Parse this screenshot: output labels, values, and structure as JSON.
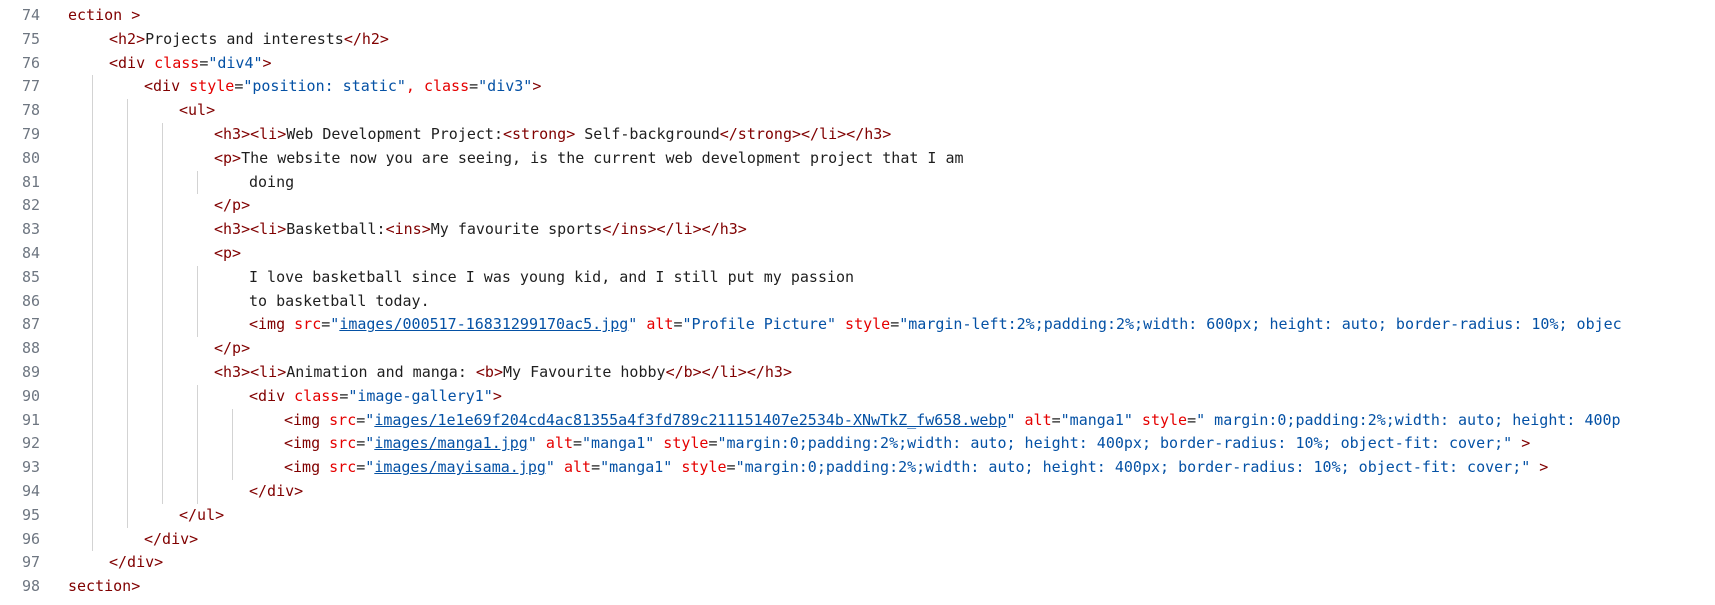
{
  "editor": {
    "lines": [
      {
        "number": "74",
        "indent": 0,
        "tokens": [
          {
            "c": "p",
            "t": "ection >"
          }
        ]
      },
      {
        "number": "75",
        "indent": 1,
        "tokens": [
          {
            "c": "p",
            "t": "<h2>"
          },
          {
            "c": "t",
            "t": "Projects and interests"
          },
          {
            "c": "p",
            "t": "</h2>"
          }
        ]
      },
      {
        "number": "76",
        "indent": 1,
        "tokens": [
          {
            "c": "p",
            "t": "<div "
          },
          {
            "c": "a",
            "t": "class"
          },
          {
            "c": "t",
            "t": "="
          },
          {
            "c": "v",
            "t": "\"div4\""
          },
          {
            "c": "p",
            "t": ">"
          }
        ]
      },
      {
        "number": "77",
        "indent": 2,
        "tokens": [
          {
            "c": "p",
            "t": "<div "
          },
          {
            "c": "a",
            "t": "style"
          },
          {
            "c": "t",
            "t": "="
          },
          {
            "c": "v",
            "t": "\"position: static\""
          },
          {
            "c": "a",
            "t": ", class"
          },
          {
            "c": "t",
            "t": "="
          },
          {
            "c": "v",
            "t": "\"div3\""
          },
          {
            "c": "p",
            "t": ">"
          }
        ]
      },
      {
        "number": "78",
        "indent": 3,
        "tokens": [
          {
            "c": "p",
            "t": "<ul>"
          }
        ]
      },
      {
        "number": "79",
        "indent": 4,
        "tokens": [
          {
            "c": "p",
            "t": "<h3><li>"
          },
          {
            "c": "t",
            "t": "Web Development Project:"
          },
          {
            "c": "p",
            "t": "<strong>"
          },
          {
            "c": "t",
            "t": " Self-background"
          },
          {
            "c": "p",
            "t": "</strong></li></h3>"
          }
        ]
      },
      {
        "number": "80",
        "indent": 4,
        "tokens": [
          {
            "c": "p",
            "t": "<p>"
          },
          {
            "c": "t",
            "t": "The website now you are seeing, is the current web development project that I am"
          }
        ]
      },
      {
        "number": "81",
        "indent": 5,
        "tokens": [
          {
            "c": "t",
            "t": "doing"
          }
        ]
      },
      {
        "number": "82",
        "indent": 4,
        "tokens": [
          {
            "c": "p",
            "t": "</p>"
          }
        ]
      },
      {
        "number": "83",
        "indent": 4,
        "tokens": [
          {
            "c": "p",
            "t": "<h3><li>"
          },
          {
            "c": "t",
            "t": "Basketball:"
          },
          {
            "c": "p",
            "t": "<ins>"
          },
          {
            "c": "t",
            "t": "My favourite sports"
          },
          {
            "c": "p",
            "t": "</ins></li></h3>"
          }
        ]
      },
      {
        "number": "84",
        "indent": 4,
        "tokens": [
          {
            "c": "p",
            "t": "<p>"
          }
        ]
      },
      {
        "number": "85",
        "indent": 5,
        "tokens": [
          {
            "c": "t",
            "t": "I love basketball since I was young kid, and I still put my passion"
          }
        ]
      },
      {
        "number": "86",
        "indent": 5,
        "tokens": [
          {
            "c": "t",
            "t": "to basketball today."
          }
        ]
      },
      {
        "number": "87",
        "indent": 5,
        "tokens": [
          {
            "c": "p",
            "t": "<img "
          },
          {
            "c": "a",
            "t": "src"
          },
          {
            "c": "t",
            "t": "="
          },
          {
            "c": "v",
            "t": "\""
          },
          {
            "c": "u",
            "t": "images/000517-16831299170ac5.jpg"
          },
          {
            "c": "v",
            "t": "\""
          },
          {
            "c": "a",
            "t": " alt"
          },
          {
            "c": "t",
            "t": "="
          },
          {
            "c": "v",
            "t": "\"Profile Picture\""
          },
          {
            "c": "a",
            "t": " style"
          },
          {
            "c": "t",
            "t": "="
          },
          {
            "c": "v",
            "t": "\"margin-left:2%;padding:2%;width: 600px; height: auto; border-radius: 10%; objec"
          }
        ]
      },
      {
        "number": "88",
        "indent": 4,
        "tokens": [
          {
            "c": "p",
            "t": "</p>"
          }
        ]
      },
      {
        "number": "89",
        "indent": 4,
        "tokens": [
          {
            "c": "p",
            "t": "<h3><li>"
          },
          {
            "c": "t",
            "t": "Animation and manga: "
          },
          {
            "c": "p",
            "t": "<b>"
          },
          {
            "c": "t",
            "t": "My Favourite hobby"
          },
          {
            "c": "p",
            "t": "</b></li></h3>"
          }
        ]
      },
      {
        "number": "90",
        "indent": 5,
        "tokens": [
          {
            "c": "p",
            "t": "<div "
          },
          {
            "c": "a",
            "t": "class"
          },
          {
            "c": "t",
            "t": "="
          },
          {
            "c": "v",
            "t": "\"image-gallery1\""
          },
          {
            "c": "p",
            "t": ">"
          }
        ]
      },
      {
        "number": "91",
        "indent": 6,
        "tokens": [
          {
            "c": "p",
            "t": "<img "
          },
          {
            "c": "a",
            "t": "src"
          },
          {
            "c": "t",
            "t": "="
          },
          {
            "c": "v",
            "t": "\""
          },
          {
            "c": "u",
            "t": "images/1e1e69f204cd4ac81355a4f3fd789c211151407e2534b-XNwTkZ_fw658.webp"
          },
          {
            "c": "v",
            "t": "\""
          },
          {
            "c": "a",
            "t": " alt"
          },
          {
            "c": "t",
            "t": "="
          },
          {
            "c": "v",
            "t": "\"manga1\""
          },
          {
            "c": "a",
            "t": " style"
          },
          {
            "c": "t",
            "t": "="
          },
          {
            "c": "v",
            "t": "\" margin:0;padding:2%;width: auto; height: 400p"
          }
        ]
      },
      {
        "number": "92",
        "indent": 6,
        "tokens": [
          {
            "c": "p",
            "t": "<img "
          },
          {
            "c": "a",
            "t": "src"
          },
          {
            "c": "t",
            "t": "="
          },
          {
            "c": "v",
            "t": "\""
          },
          {
            "c": "u",
            "t": "images/manga1.jpg"
          },
          {
            "c": "v",
            "t": "\""
          },
          {
            "c": "a",
            "t": " alt"
          },
          {
            "c": "t",
            "t": "="
          },
          {
            "c": "v",
            "t": "\"manga1\""
          },
          {
            "c": "a",
            "t": " style"
          },
          {
            "c": "t",
            "t": "="
          },
          {
            "c": "v",
            "t": "\"margin:0;padding:2%;width: auto; height: 400px; border-radius: 10%; object-fit: cover;\""
          },
          {
            "c": "p",
            "t": " >"
          }
        ]
      },
      {
        "number": "93",
        "indent": 6,
        "tokens": [
          {
            "c": "p",
            "t": "<img "
          },
          {
            "c": "a",
            "t": "src"
          },
          {
            "c": "t",
            "t": "="
          },
          {
            "c": "v",
            "t": "\""
          },
          {
            "c": "u",
            "t": "images/mayisama.jpg"
          },
          {
            "c": "v",
            "t": "\""
          },
          {
            "c": "a",
            "t": " alt"
          },
          {
            "c": "t",
            "t": "="
          },
          {
            "c": "v",
            "t": "\"manga1\""
          },
          {
            "c": "a",
            "t": " style"
          },
          {
            "c": "t",
            "t": "="
          },
          {
            "c": "v",
            "t": "\"margin:0;padding:2%;width: auto; height: 400px; border-radius: 10%; object-fit: cover;\""
          },
          {
            "c": "p",
            "t": " >"
          }
        ]
      },
      {
        "number": "94",
        "indent": 5,
        "tokens": [
          {
            "c": "p",
            "t": "</div>"
          }
        ]
      },
      {
        "number": "95",
        "indent": 3,
        "tokens": [
          {
            "c": "p",
            "t": "</ul>"
          }
        ]
      },
      {
        "number": "96",
        "indent": 2,
        "tokens": [
          {
            "c": "p",
            "t": "</div>"
          }
        ]
      },
      {
        "number": "97",
        "indent": 1,
        "tokens": [
          {
            "c": "p",
            "t": "</div>"
          }
        ]
      },
      {
        "number": "98",
        "indent": 0,
        "tokens": [
          {
            "c": "p",
            "t": "section>"
          }
        ]
      }
    ]
  }
}
